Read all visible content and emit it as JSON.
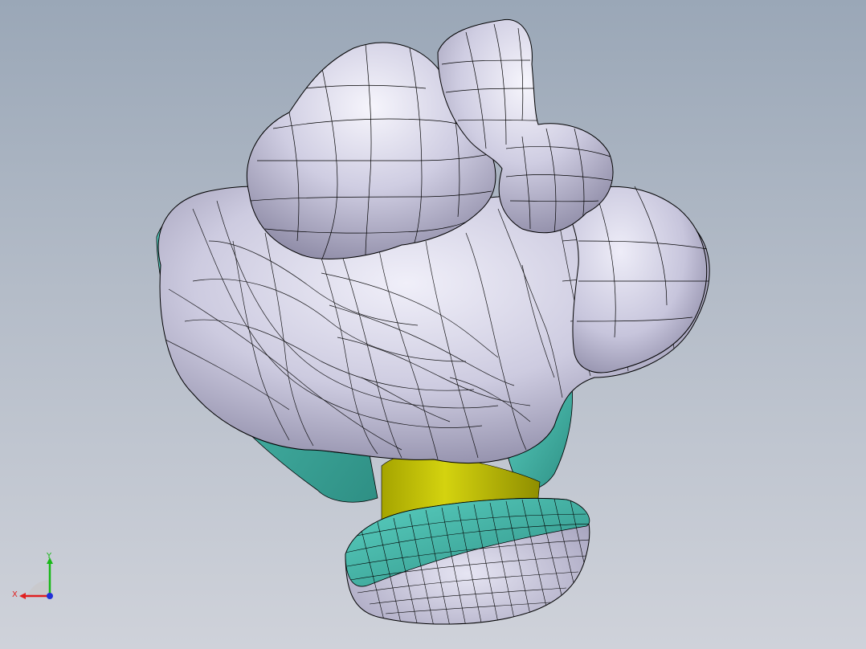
{
  "viewport": {
    "background_top": "#9aa7b7",
    "background_bottom": "#cfd2da"
  },
  "model": {
    "surface_color": "#cdcbe0",
    "highlight_color": "#f2f1fa",
    "shadow_color": "#8d8aa6",
    "teal_color": "#4fc1b3",
    "yellow_color": "#c3c20b",
    "edge_color": "#000000"
  },
  "triad": {
    "x_label": "X",
    "y_label": "Y",
    "x_color": "#e02020",
    "y_color": "#18b818",
    "z_color": "#2030d8"
  }
}
